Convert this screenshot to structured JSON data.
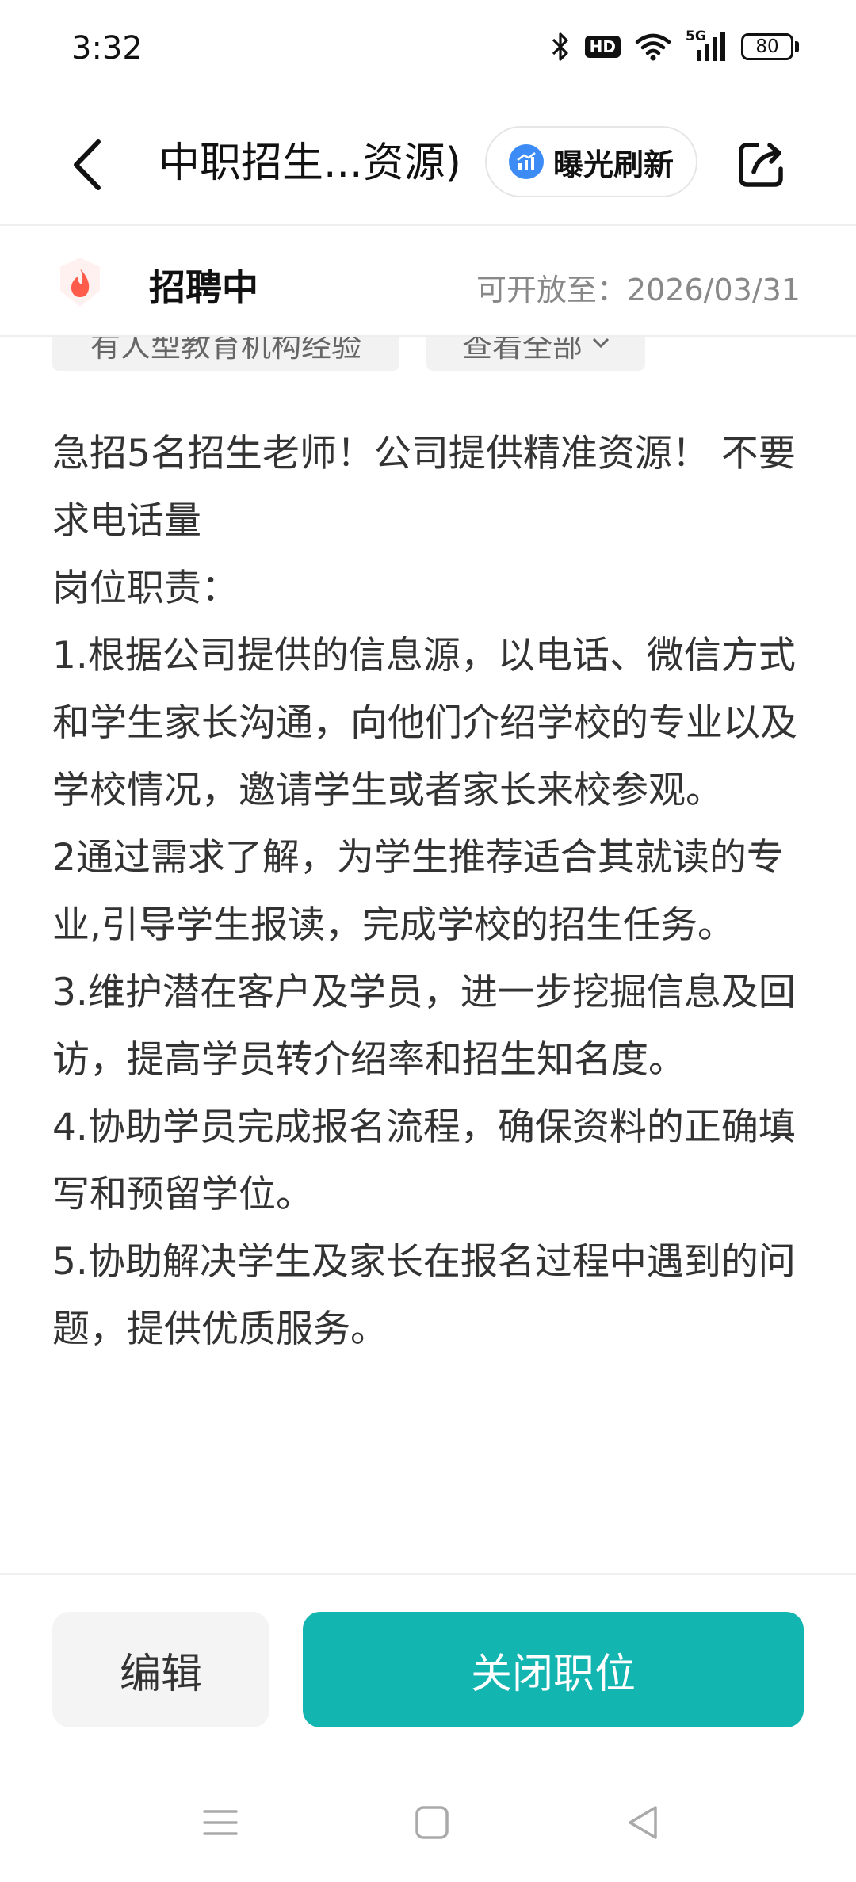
{
  "status_bar": {
    "time": "3:32",
    "battery": "80",
    "hd_label": "HD",
    "network_label": "5G",
    "icons": [
      "bluetooth-icon",
      "hd-icon",
      "wifi-icon",
      "signal-5g-icon",
      "battery-icon"
    ]
  },
  "header": {
    "title": "中职招生...资源)",
    "refresh_label": "曝光刷新",
    "icons": [
      "back-arrow-icon",
      "chart-icon",
      "share-icon"
    ],
    "accent_color": "#3d8cf5"
  },
  "job_status": {
    "status": "招聘中",
    "open_until": "可开放至：2026/03/31",
    "badge_icon": "flame-icon",
    "badge_color": "#ff5b4a"
  },
  "tags": {
    "tag1": "有人型教育机构经验",
    "view_all": "查看全部"
  },
  "description": {
    "lines": [
      "急招5名招生老师！公司提供精准资源！ 不要求电话量",
      "岗位职责：",
      "1.根据公司提供的信息源，以电话、微信方式和学生家长沟通，向他们介绍学校的专业以及学校情况，邀请学生或者家长来校参观。",
      "2通过需求了解，为学生推荐适合其就读的专业,引导学生报读，完成学校的招生任务。",
      "3.维护潜在客户及学员，进一步挖掘信息及回访，提高学员转介绍率和招生知名度。",
      "4.协助学员完成报名流程，确保资料的正确填写和预留学位。",
      "5.协助解决学生及家长在报名过程中遇到的问题，提供优质服务。"
    ]
  },
  "actions": {
    "edit": "编辑",
    "close_position": "关闭职位",
    "primary_color": "#13b5b1"
  },
  "nav_bar": {
    "icons": [
      "menu-icon",
      "home-square-icon",
      "back-triangle-icon"
    ]
  }
}
